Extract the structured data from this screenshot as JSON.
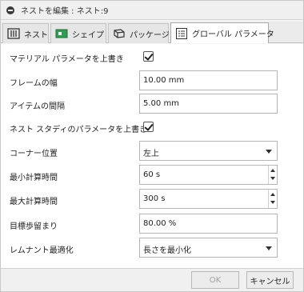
{
  "window": {
    "title": "ネストを編集 : ネスト:9"
  },
  "tabs": [
    {
      "label": "ネスト",
      "icon": "nest-icon",
      "active": false
    },
    {
      "label": "シェイプ",
      "icon": "shape-icon",
      "active": false
    },
    {
      "label": "パッケージ",
      "icon": "package-icon",
      "active": false
    },
    {
      "label": "グローバル パラメータ",
      "icon": "global-parameters-icon",
      "active": true
    }
  ],
  "params": {
    "override_material": {
      "label": "マテリアル パラメータを上書き",
      "checked": true
    },
    "frame_width": {
      "label": "フレームの幅",
      "value": "10.00 mm"
    },
    "item_spacing": {
      "label": "アイテムの間隔",
      "value": "5.00 mm"
    },
    "override_nest_study": {
      "label": "ネスト スタディのパラメータを上書き",
      "checked": true
    },
    "corner_position": {
      "label": "コーナー位置",
      "value": "左上"
    },
    "min_compute_time": {
      "label": "最小計算時間",
      "value": "60 s"
    },
    "max_compute_time": {
      "label": "最大計算時間",
      "value": "300 s"
    },
    "target_yield": {
      "label": "目標歩留まり",
      "value": "80.00 %"
    },
    "remnant_optimization": {
      "label": "レムナント最適化",
      "value": "長さを最小化"
    }
  },
  "footer": {
    "ok_label": "OK",
    "cancel_label": "キャンセル"
  },
  "colors": {
    "tab_active_bg": "#ffffff",
    "shape_icon_green": "#2e9e4f"
  }
}
